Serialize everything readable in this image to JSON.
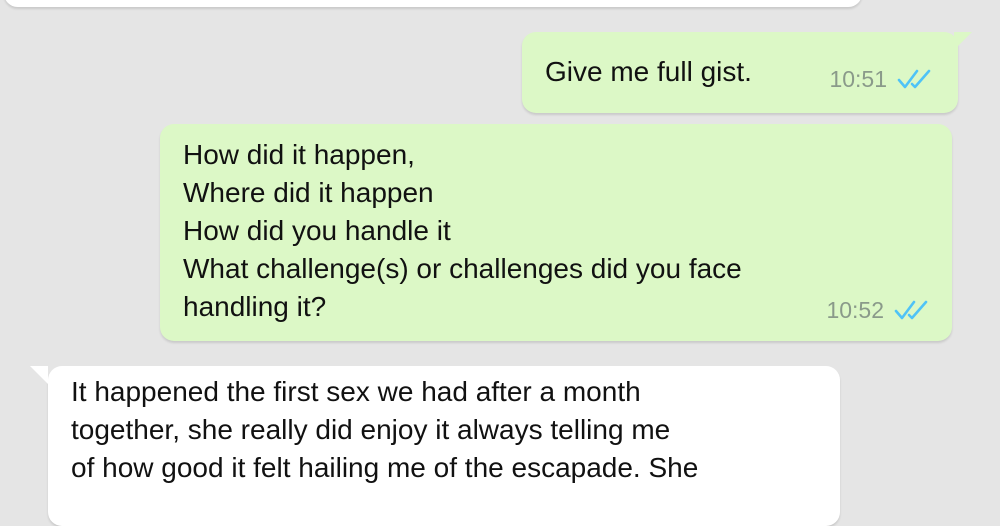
{
  "conversation": {
    "messages": [
      {
        "direction": "outgoing",
        "text": "Give me full gist.",
        "time": "10:51",
        "status_icon": "double-check-icon",
        "status_color": "#4fc3f7"
      },
      {
        "direction": "outgoing",
        "text": "How did it happen,\nWhere did it happen\nHow did you handle it\nWhat challenge(s) or challenges did you face\nhandling it?",
        "time": "10:52",
        "status_icon": "double-check-icon",
        "status_color": "#4fc3f7"
      },
      {
        "direction": "incoming",
        "text": "It happened the first sex we had after a month\ntogether, she really did enjoy it always telling me\nof how good it felt hailing me of the escapade. She"
      }
    ]
  },
  "colors": {
    "background": "#e5e5e5",
    "outgoing_bubble": "#dcf8c6",
    "incoming_bubble": "#ffffff",
    "read_ticks": "#4fc3f7"
  }
}
